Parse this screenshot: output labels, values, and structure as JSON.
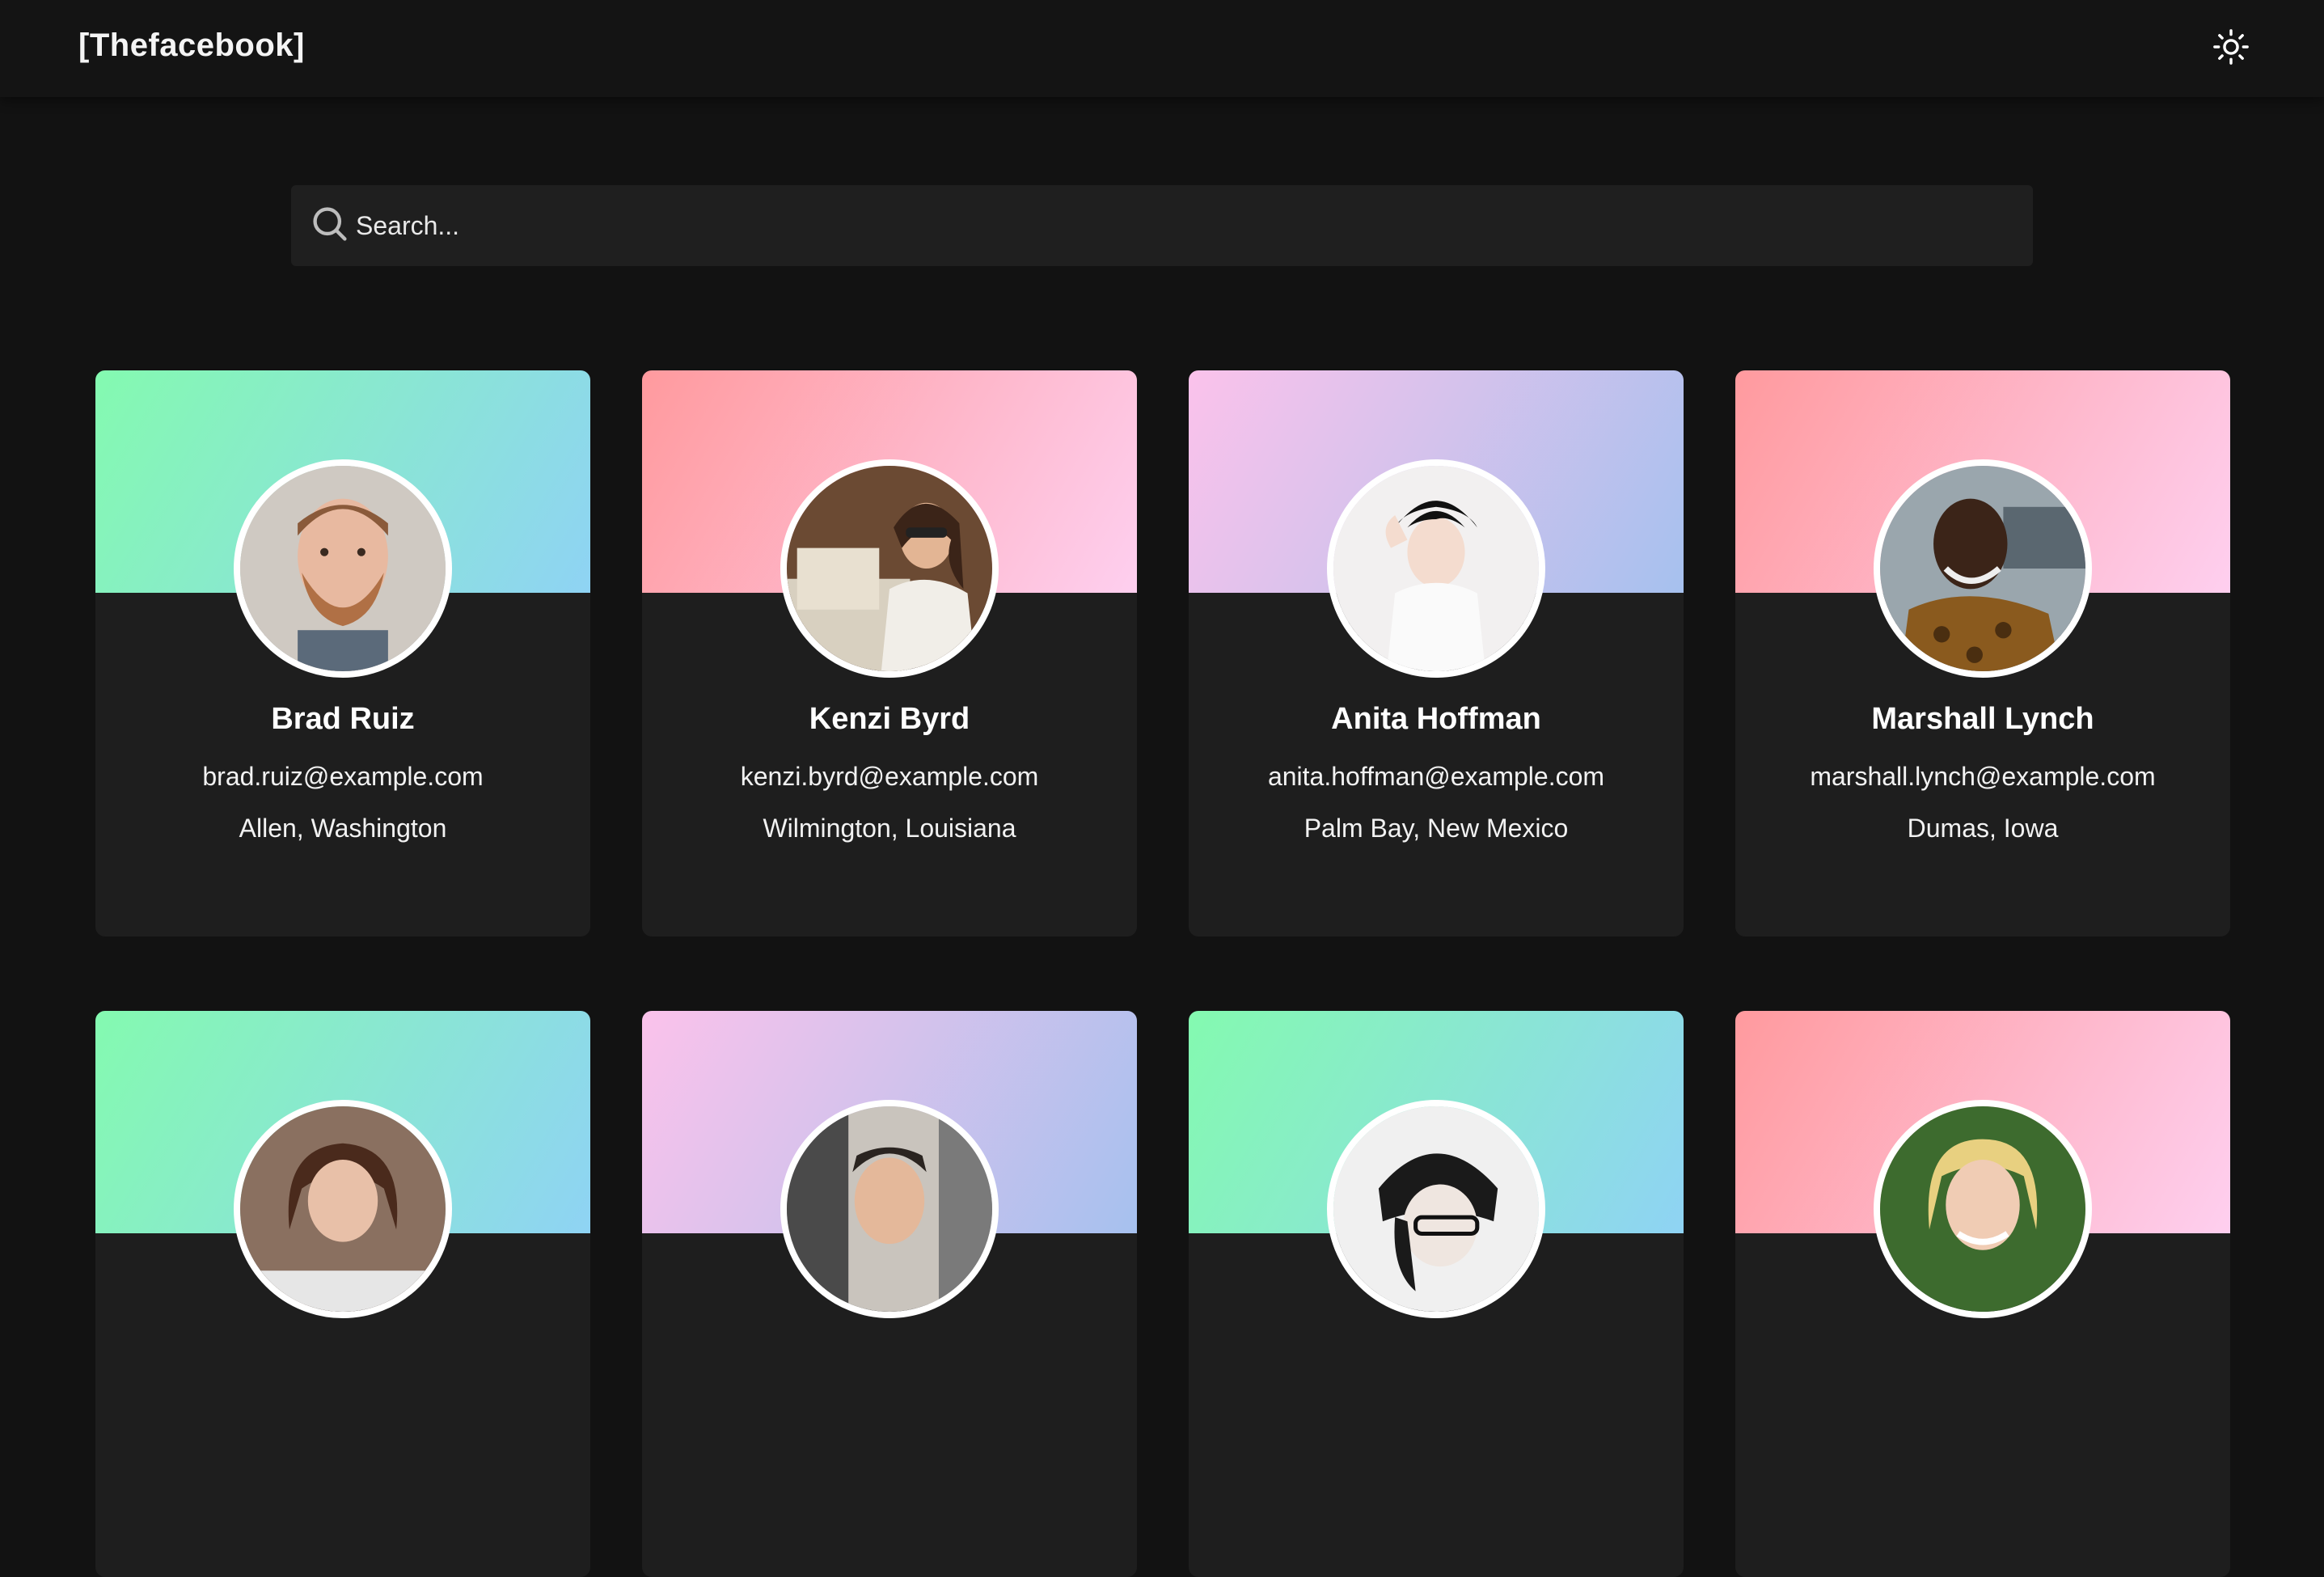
{
  "header": {
    "brand": "[Thefacebook]",
    "theme_toggle_icon": "sun-icon"
  },
  "search": {
    "placeholder": "Search...",
    "value": "",
    "icon": "search-icon"
  },
  "users": [
    {
      "name": "Brad Ruiz",
      "email": "brad.ruiz@example.com",
      "location": "Allen, Washington",
      "banner": "green"
    },
    {
      "name": "Kenzi Byrd",
      "email": "kenzi.byrd@example.com",
      "location": "Wilmington, Louisiana",
      "banner": "pink"
    },
    {
      "name": "Anita Hoffman",
      "email": "anita.hoffman@example.com",
      "location": "Palm Bay, New Mexico",
      "banner": "purple"
    },
    {
      "name": "Marshall Lynch",
      "email": "marshall.lynch@example.com",
      "location": "Dumas, Iowa",
      "banner": "pink"
    },
    {
      "banner": "green"
    },
    {
      "banner": "purple"
    },
    {
      "banner": "green"
    },
    {
      "banner": "pink"
    }
  ],
  "colors": {
    "background": "#121212",
    "card": "#1e1e1e",
    "gradient_green": [
      "#84fab0",
      "#8fd3f4"
    ],
    "gradient_pink": [
      "#ff9a9e",
      "#fecfef"
    ],
    "gradient_purple": [
      "#fbc2eb",
      "#a6c1ee"
    ]
  }
}
